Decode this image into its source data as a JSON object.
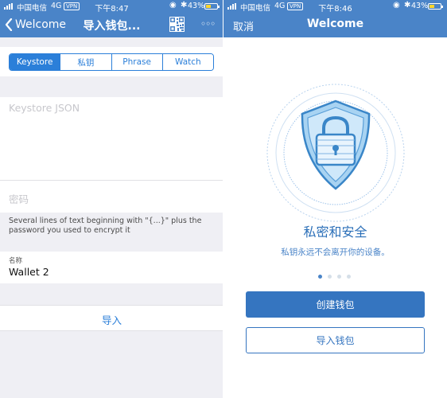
{
  "status_left": {
    "carrier": "中国电信",
    "network": "4G",
    "vpn": "VPN",
    "time": "下午8:47",
    "battery_pct": "43%",
    "battery_level": 0.43
  },
  "status_right": {
    "carrier": "中国电信",
    "network": "4G",
    "vpn": "VPN",
    "time": "下午8:46",
    "battery_pct": "43%",
    "battery_level": 0.43
  },
  "left_nav": {
    "back_label": "Welcome",
    "title": "导入钱包...",
    "qr_icon": "qr-code-icon",
    "more_icon": "more-icon",
    "more_glyph": "◦◦◦"
  },
  "tabs": [
    {
      "label": "Keystore",
      "active": true
    },
    {
      "label": "私钥",
      "active": false
    },
    {
      "label": "Phrase",
      "active": false
    },
    {
      "label": "Watch",
      "active": false
    }
  ],
  "form": {
    "keystore_placeholder": "Keystore JSON",
    "password_placeholder": "密码",
    "hint": "Several lines of text beginning with \"{...}\" plus the password you used to encrypt it",
    "name_label": "名称",
    "name_value": "Wallet 2",
    "import_button": "导入"
  },
  "right_nav": {
    "cancel_label": "取消",
    "title": "Welcome"
  },
  "onboarding": {
    "title": "私密和安全",
    "subtitle": "私钥永远不会离开你的设备。",
    "page_count": 4,
    "current_page": 1,
    "create_button": "创建钱包",
    "import_button": "导入钱包"
  },
  "colors": {
    "nav_bar": "#4a84c8",
    "accent": "#2b7fd9",
    "primary_button": "#3575c0",
    "background": "#efeff4"
  }
}
